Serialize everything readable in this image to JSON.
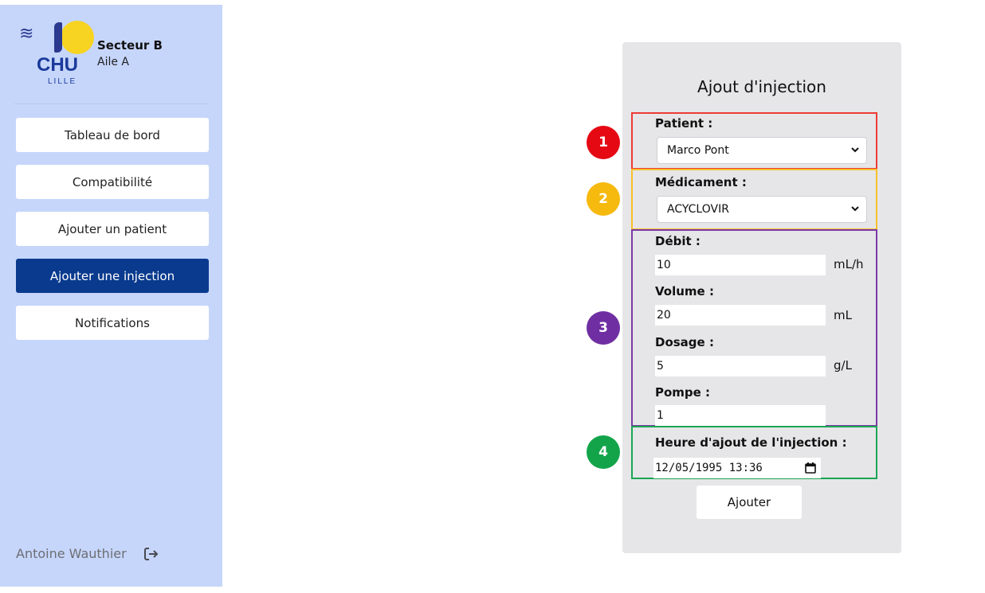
{
  "sidebar": {
    "logo": {
      "text": "CHU",
      "subtext": "LILLE"
    },
    "sector": "Secteur B",
    "wing": "Aile A",
    "nav": [
      {
        "label": "Tableau de bord",
        "active": false
      },
      {
        "label": "Compatibilité",
        "active": false
      },
      {
        "label": "Ajouter un patient",
        "active": false
      },
      {
        "label": "Ajouter une injection",
        "active": true
      },
      {
        "label": "Notifications",
        "active": false
      }
    ],
    "user": {
      "name": "Antoine Wauthier",
      "icon": "logout-icon"
    },
    "colors": {
      "background": "#c6d6fb",
      "active": "#093a8e"
    }
  },
  "form": {
    "title": "Ajout d'injection",
    "patient": {
      "label": "Patient :",
      "value": "Marco Pont"
    },
    "medication": {
      "label": "Médicament :",
      "value": "ACYCLOVIR"
    },
    "flow_rate": {
      "label": "Débit :",
      "value": "10",
      "unit": "mL/h"
    },
    "volume": {
      "label": "Volume :",
      "value": "20",
      "unit": "mL"
    },
    "dosage": {
      "label": "Dosage :",
      "value": "5",
      "unit": "g/L"
    },
    "pump": {
      "label": "Pompe :",
      "value": "1"
    },
    "time": {
      "label": "Heure d'ajout de l'injection :",
      "value": "12/05/1995 13:36"
    },
    "submit_label": "Ajouter"
  },
  "markers": [
    {
      "number": "1",
      "color": "#e50914"
    },
    {
      "number": "2",
      "color": "#f6b90e"
    },
    {
      "number": "3",
      "color": "#6f2fa2"
    },
    {
      "number": "4",
      "color": "#13a44a"
    }
  ],
  "group_colors": {
    "red": "#ee3a36",
    "yellow": "#f7c02b",
    "purple": "#7b3aa6",
    "green": "#1aa653"
  }
}
